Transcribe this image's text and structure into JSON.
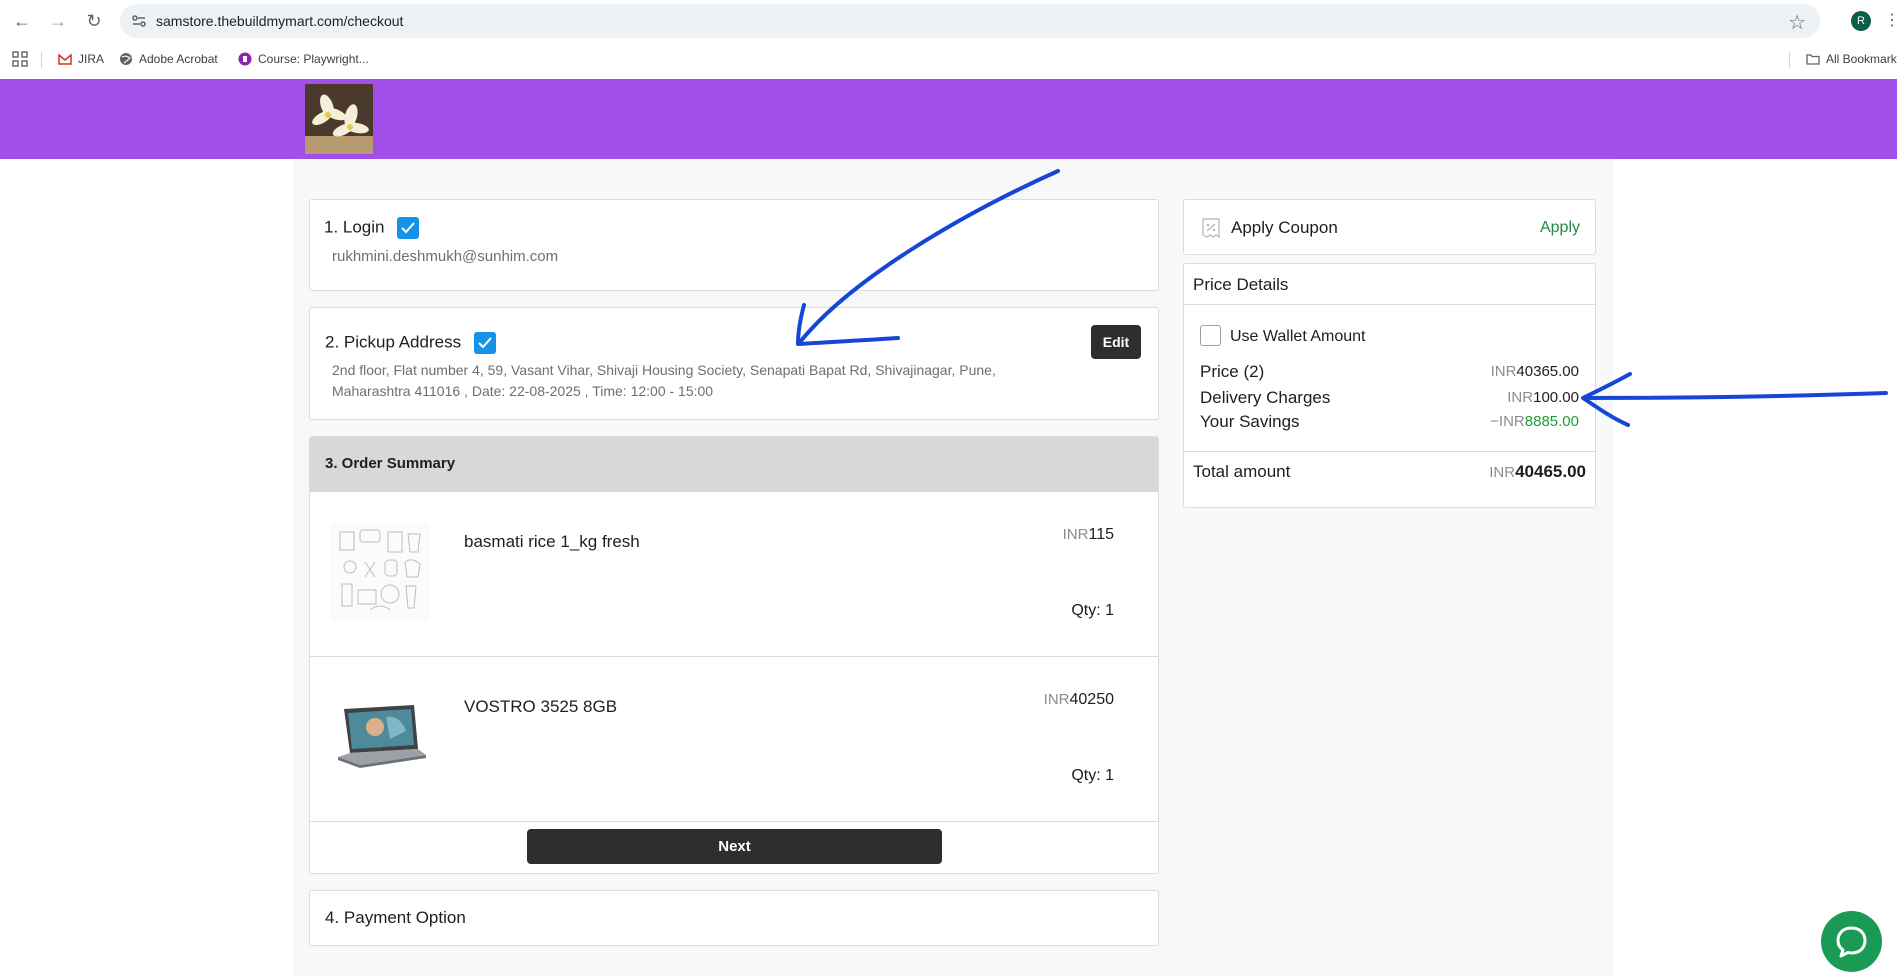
{
  "browser": {
    "url": "samstore.thebuildmymart.com/checkout",
    "profile_initial": "R",
    "bookmarks": [
      "JIRA",
      "Adobe Acrobat",
      "Course: Playwright...",
      "All Bookmarks"
    ]
  },
  "icons": {
    "back": "arrow-left-icon",
    "forward": "arrow-right-icon",
    "reload": "reload-icon",
    "star": "star-icon",
    "apps": "apps-grid-icon",
    "coupon": "coupon-icon",
    "chat": "chat-icon"
  },
  "colors": {
    "header": "#a24ee9",
    "accent": "#1593e6",
    "apply": "#1f8a45",
    "savings": "#1f9c3a",
    "button": "#2e2e2e",
    "chat": "#1a9a54",
    "annotation": "#1546d6"
  },
  "login": {
    "title": "1. Login",
    "email": "rukhmini.deshmukh@sunhim.com"
  },
  "pickup": {
    "title": "2. Pickup Address",
    "edit_label": "Edit",
    "address_line1": "2nd floor, Flat number 4, 59, Vasant Vihar, Shivaji Housing Society, Senapati Bapat Rd, Shivajinagar, Pune,",
    "address_line2": "Maharashtra 411016 , Date: 22-08-2025 , Time: 12:00 - 15:00"
  },
  "order_summary": {
    "title": "3. Order Summary",
    "items": [
      {
        "name": "basmati rice 1_kg fresh",
        "currency": "INR",
        "price": "115",
        "qty": "Qty: 1"
      },
      {
        "name": "VOSTRO 3525 8GB",
        "currency": "INR",
        "price": "40250",
        "qty": "Qty: 1"
      }
    ],
    "next_label": "Next"
  },
  "payment": {
    "title": "4. Payment Option"
  },
  "coupon": {
    "label": "Apply Coupon",
    "apply_label": "Apply"
  },
  "price_details": {
    "title": "Price Details",
    "wallet_label": "Use Wallet Amount",
    "price_label": "Price (2)",
    "price_currency": "INR",
    "price_value": "40365.00",
    "delivery_label": "Delivery Charges",
    "delivery_currency": "INR",
    "delivery_value": "100.00",
    "savings_label": "Your Savings",
    "savings_currency": "−INR",
    "savings_value": "8885.00",
    "total_label": "Total amount",
    "total_currency": "INR",
    "total_value": "40465.00"
  }
}
